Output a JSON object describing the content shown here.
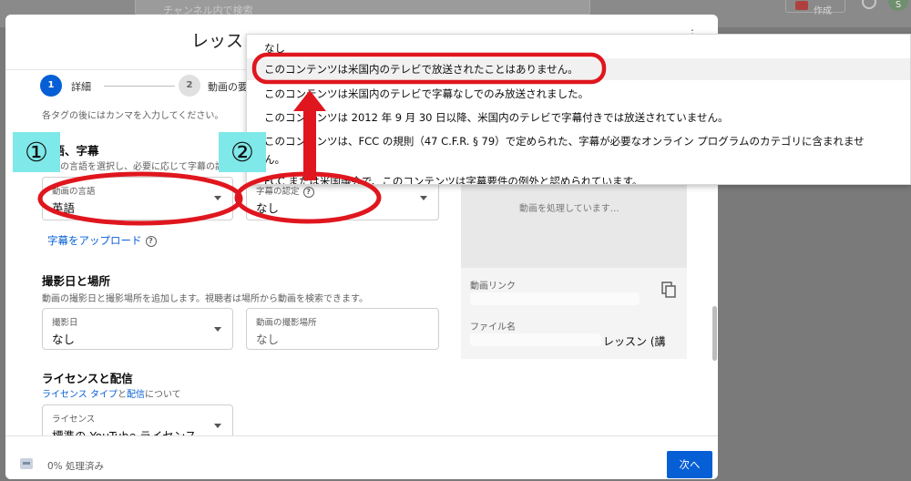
{
  "background": {
    "search_placeholder": "チャンネル内で検索",
    "create_label": "作成",
    "avatar_initial": "S"
  },
  "dialog": {
    "title": "レッスン",
    "steps": [
      {
        "number": "1",
        "label": "詳細"
      },
      {
        "number": "2",
        "label": "動画の要素"
      }
    ]
  },
  "form": {
    "tags_hint": "各タグの後にはカンマを入力してください。",
    "language_section": {
      "title": "言語、字幕",
      "desc": "動画の言語を選択し、必要に応じて字幕の認定を選択します。",
      "video_language_label": "動画の言語",
      "video_language_value": "英語",
      "caption_cert_label": "字幕の認定",
      "caption_cert_value": "なし",
      "upload_subtitles": "字幕をアップロード"
    },
    "recording_section": {
      "title": "撮影日と場所",
      "desc": "動画の撮影日と撮影場所を追加します。視聴者は場所から動画を検索できます。",
      "date_label": "撮影日",
      "date_value": "なし",
      "location_label": "動画の撮影場所",
      "location_placeholder": "なし"
    },
    "license_section": {
      "title": "ライセンスと配信",
      "desc_link1": "ライセンス タイプ",
      "desc_mid": "と",
      "desc_link2": "配信",
      "desc_tail": "について",
      "license_label": "ライセンス",
      "license_value": "標準の YouTube ライセンス"
    }
  },
  "preview": {
    "processing_text": "動画を処理しています…",
    "link_label": "動画リンク",
    "filename_label": "ファイル名",
    "filename_tail": "レッスン (講"
  },
  "footer": {
    "status": "0% 処理済み",
    "next_label": "次へ"
  },
  "dropdown": {
    "options": [
      "なし",
      "このコンテンツは米国内のテレビで放送されたことはありません。",
      "このコンテンツは米国内のテレビで字幕なしでのみ放送されました。",
      "このコンテンツは 2012 年 9 月 30 日以降、米国内のテレビで字幕付きでは放送されていません。",
      "このコンテンツは、FCC の規則（47 C.F.R. § 79）で定められた、字幕が必要なオンライン プログラムのカテゴリに含まれませ",
      "ん。",
      "FCC または米国議会で、このコンテンツは字幕要件の例外と認められています。"
    ]
  },
  "annotations": {
    "badge1": "①",
    "badge2": "②",
    "highlight_color": "#e0161e",
    "badge_color": "#7fe8e8"
  },
  "colors": {
    "accent": "#065fd4",
    "overlay": "#7a7a7a"
  }
}
